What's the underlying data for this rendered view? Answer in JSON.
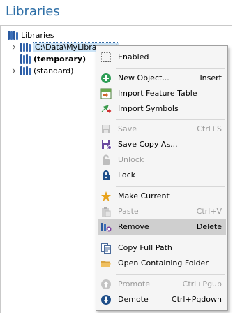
{
  "panel": {
    "title": "Libraries"
  },
  "tree": {
    "root_label": "Libraries",
    "items": [
      {
        "label": "C:\\Data\\MyLibrary.pol",
        "selected": true,
        "bold": false
      },
      {
        "label": "(temporary)",
        "selected": false,
        "bold": true
      },
      {
        "label": "(standard)",
        "selected": false,
        "bold": false
      }
    ]
  },
  "context_menu": {
    "items": [
      {
        "label": "Enabled",
        "shortcut": "",
        "icon": "checkbox-dashed-icon",
        "disabled": false
      },
      {
        "label": "New Object...",
        "shortcut": "Insert",
        "icon": "add-circle-icon",
        "disabled": false
      },
      {
        "label": "Import Feature Table",
        "shortcut": "",
        "icon": "import-table-icon",
        "disabled": false
      },
      {
        "label": "Import Symbols",
        "shortcut": "",
        "icon": "import-symbols-icon",
        "disabled": false
      },
      {
        "label": "Save",
        "shortcut": "Ctrl+S",
        "icon": "save-icon",
        "disabled": true
      },
      {
        "label": "Save Copy As...",
        "shortcut": "",
        "icon": "save-copy-icon",
        "disabled": false
      },
      {
        "label": "Unlock",
        "shortcut": "",
        "icon": "unlock-icon",
        "disabled": true
      },
      {
        "label": "Lock",
        "shortcut": "",
        "icon": "lock-icon",
        "disabled": false
      },
      {
        "label": "Make Current",
        "shortcut": "",
        "icon": "star-icon",
        "disabled": false
      },
      {
        "label": "Paste",
        "shortcut": "Ctrl+V",
        "icon": "paste-icon",
        "disabled": true
      },
      {
        "label": "Remove",
        "shortcut": "Delete",
        "icon": "remove-library-icon",
        "disabled": false,
        "highlighted": true
      },
      {
        "label": "Copy Full Path",
        "shortcut": "",
        "icon": "copy-path-icon",
        "disabled": false
      },
      {
        "label": "Open Containing Folder",
        "shortcut": "",
        "icon": "folder-icon",
        "disabled": false
      },
      {
        "label": "Promote",
        "shortcut": "Ctrl+Pgup",
        "icon": "arrow-up-circle-icon",
        "disabled": true
      },
      {
        "label": "Demote",
        "shortcut": "Ctrl+Pgdown",
        "icon": "arrow-down-circle-icon",
        "disabled": false
      }
    ]
  },
  "colors": {
    "title": "#2d6ea6",
    "accent_blue": "#2b5aa0",
    "menu_bg": "#f5f5f5",
    "highlight": "#cfcfcf",
    "add_green": "#2f9e57"
  }
}
